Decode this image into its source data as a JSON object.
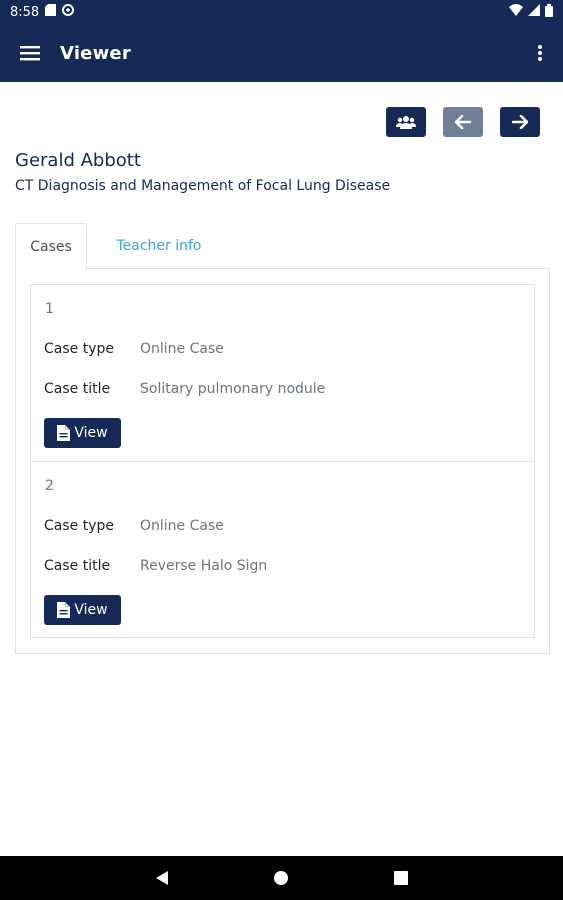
{
  "status_bar": {
    "time": "8:58"
  },
  "app_bar": {
    "title": "Viewer"
  },
  "header": {
    "name": "Gerald Abbott",
    "course": "CT Diagnosis and Management of Focal Lung Disease"
  },
  "tabs": [
    {
      "label": "Cases",
      "active": true
    },
    {
      "label": "Teacher info",
      "active": false
    }
  ],
  "cases": [
    {
      "number": "1",
      "type_label": "Case type",
      "type_value": "Online Case",
      "title_label": "Case title",
      "title_value": "Solitary pulmonary nodule",
      "button_label": "View"
    },
    {
      "number": "2",
      "type_label": "Case type",
      "type_value": "Online Case",
      "title_label": "Case title",
      "title_value": "Reverse Halo Sign",
      "button_label": "View"
    }
  ],
  "colors": {
    "primary": "#162a58",
    "link": "#33a3dc",
    "disabled": "#6f7f95"
  },
  "icons": [
    "menu-icon",
    "more-vert-icon",
    "group-icon",
    "arrow-left-icon",
    "arrow-right-icon",
    "file-icon",
    "back-icon",
    "home-icon",
    "recents-icon"
  ]
}
